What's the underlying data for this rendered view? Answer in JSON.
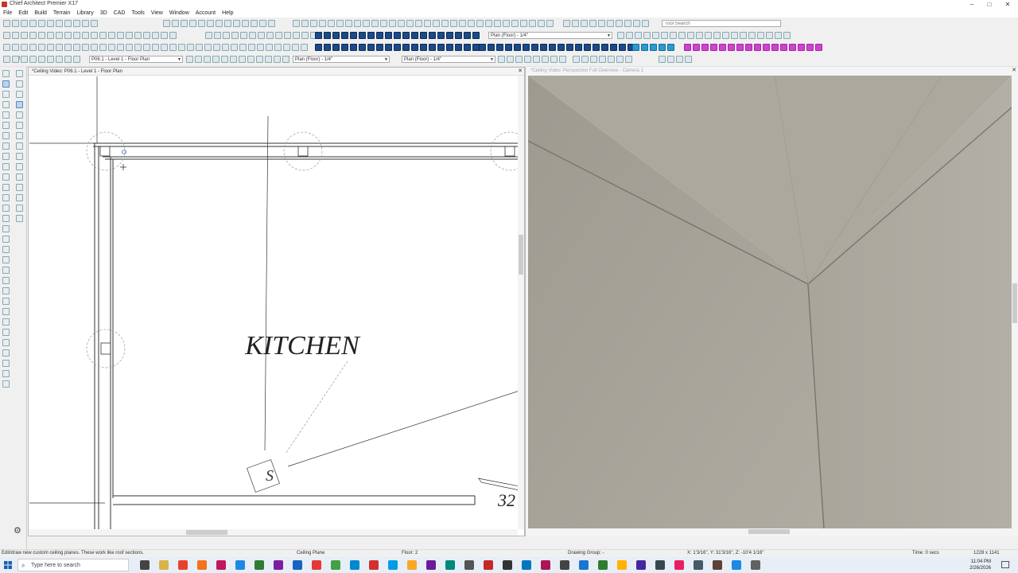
{
  "window": {
    "title": "Chief Architect Premier X17",
    "controls": [
      "–",
      "□",
      "✕"
    ]
  },
  "menu": [
    "File",
    "Edit",
    "Build",
    "Terrain",
    "Library",
    "3D",
    "CAD",
    "Tools",
    "View",
    "Window",
    "Account",
    "Help"
  ],
  "toolbar": {
    "search_placeholder": "Tool Search",
    "view_dropdown_1": "Plan (Floor) - 1/4\"",
    "floor_dropdown": "P06.1 - Level 1 - Floor Plan",
    "floor_number": "2",
    "view_dropdown_2": "Plan (Floor) - 1/4\"",
    "view_dropdown_3": "Plan (Floor) - 1/4\""
  },
  "plan_window": {
    "title": "*Ceiling Video: P06.1 - Level 1 - Floor Plan",
    "room_label": "KITCHEN",
    "camera_symbol": "S",
    "dimension_number": "32"
  },
  "camera_window": {
    "title": "*Ceiling Video: Perspective Full Overview - Camera 1"
  },
  "status": {
    "hint": "Edit/draw new custom ceiling planes. These work like roof sections.",
    "mode": "Ceiling Plane",
    "floor": "Floor: 2",
    "drawing_group": "Drawing Group: -",
    "coords": "X: 1'3/16\", Y: 31'3/16\", Z: -10'4 1/16\"",
    "time": "Time: 0 secs",
    "resolution": "1228 x 1141"
  },
  "taskbar": {
    "search_placeholder": "Type here to search",
    "time": "11:04 PM",
    "date": "2/26/2026"
  },
  "colors": {
    "camera_wall_light": "#a7a59a",
    "camera_wall_dark": "#8e8c82",
    "accent_blue": "#1a4a8a"
  }
}
